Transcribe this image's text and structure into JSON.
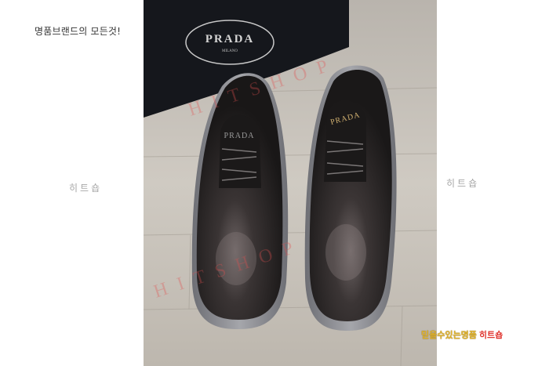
{
  "header": {
    "tagline": "명품브랜드의 모든것!"
  },
  "watermarks": {
    "left": "히트숍",
    "right": "히트숍",
    "diagonal_1": "HITSHOP",
    "diagonal_2": "HITSHOP"
  },
  "photo": {
    "box_brand": "PRADA",
    "box_sub": "MILANO",
    "left_shoe_logo": "PRADA",
    "right_shoe_logo": "PRADA"
  },
  "footer": {
    "slogan": "믿을수있는명품",
    "brand": "히트숍"
  },
  "colors": {
    "floor": "#c9c4bc",
    "box": "#15171c",
    "leather": "#2a2727",
    "sole": "#8e8f95",
    "watermark_red": "#e35050"
  }
}
